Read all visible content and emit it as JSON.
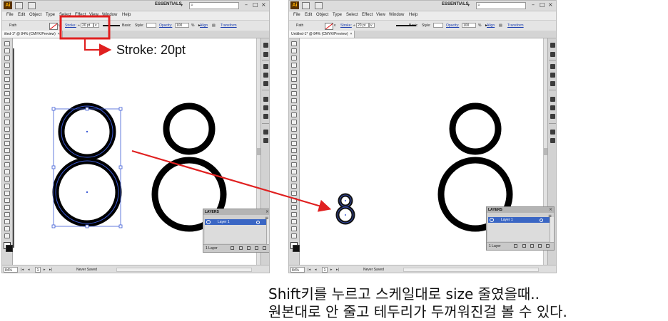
{
  "menu": [
    "File",
    "Edit",
    "Object",
    "Type",
    "Select",
    "Effect",
    "View",
    "Window",
    "Help"
  ],
  "workspace_label": "ESSENTIALS",
  "controlbar": {
    "object_type": "Path",
    "stroke_label": "Stroke:",
    "stroke_value": "20 pt",
    "brush_label": "Basic",
    "style_label": "Style:",
    "opacity_label": "Opacity:",
    "opacity_value": "100",
    "opacity_unit": "%",
    "align_label": "Align",
    "transform_label": "Transform"
  },
  "document_tab": "Untitled-1* @ 84% (CMYK/Preview)",
  "document_tab_left": "itled-1* @ 84% (CMYK/Preview)",
  "statusbar": {
    "zoom": "84%",
    "page": "1",
    "save_status": "Never Saved"
  },
  "layers_panel": {
    "title": "LAYERS",
    "layer_name": "Layer 1",
    "layer_count": "1 Layer"
  },
  "annotation": {
    "stroke_note": "Stroke: 20pt",
    "highlight_color": "#e02020",
    "arrow_color": "#e02020"
  },
  "caption": {
    "line1": "Shift키를 누르고 스케일대로 size 줄였을때..",
    "line2": "원본대로 안 줄고 테두리가 두꺼워진걸 볼 수 있다."
  },
  "colors": {
    "selection": "#3d5bd6",
    "shape_stroke": "#000000",
    "layer_highlight": "#3a66c4"
  }
}
